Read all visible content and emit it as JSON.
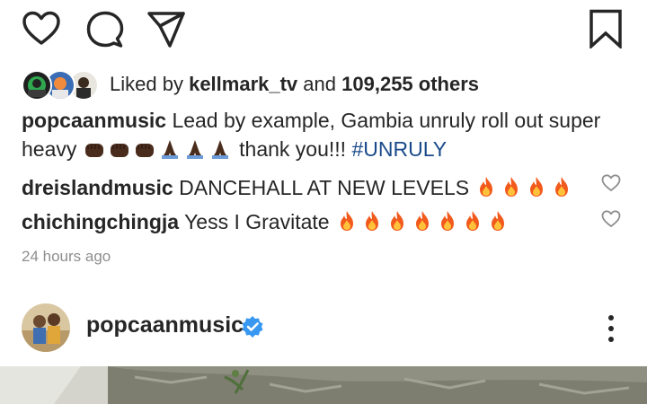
{
  "actions": {
    "like_icon": "heart-outline-icon",
    "comment_icon": "comment-bubble-icon",
    "share_icon": "paper-plane-icon",
    "save_icon": "bookmark-icon"
  },
  "likes": {
    "prefix": "Liked by",
    "user": "kellmark_tv",
    "connector": "and",
    "count_text": "109,255 others"
  },
  "caption": {
    "username": "popcaanmusic",
    "text_before_emojis": "Lead by example, Gambia unruly roll out super heavy",
    "emojis": "✊🏿✊🏿✊🏿🙏🏿🙏🏿🙏🏿",
    "text_after_emojis": "thank you!!!",
    "hashtag": "#UNRULY"
  },
  "comments": [
    {
      "username": "dreislandmusic",
      "text": "DANCEHALL AT NEW LEVELS",
      "emojis": "🔥🔥🔥🔥"
    },
    {
      "username": "chichingchingja",
      "text": "Yess I Gravitate",
      "emojis": "🔥🔥🔥🔥🔥🔥🔥"
    }
  ],
  "timestamp": "24 hours ago",
  "post": {
    "username": "popcaanmusic",
    "verified_icon": "verified-badge-icon",
    "more_icon": "more-vertical-icon"
  },
  "colors": {
    "text": "#262626",
    "muted": "#8e8e8e",
    "hashtag": "#1a4a8a",
    "verified": "#3897f0",
    "fire": "#f25a1d"
  }
}
